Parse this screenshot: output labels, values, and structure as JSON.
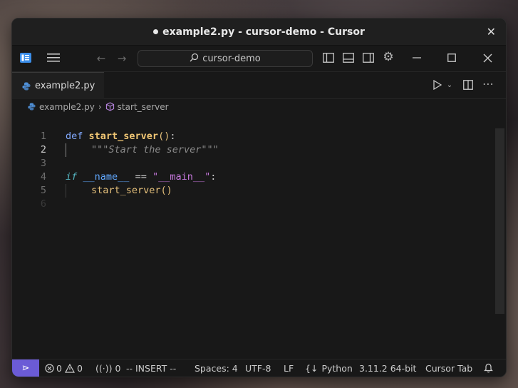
{
  "window": {
    "title": "example2.py - cursor-demo - Cursor"
  },
  "toolbar": {
    "search_text": "cursor-demo"
  },
  "tabs": [
    {
      "label": "example2.py",
      "modified": true
    }
  ],
  "breadcrumb": {
    "file": "example2.py",
    "symbol": "start_server"
  },
  "code": {
    "line_numbers": [
      "1",
      "2",
      "3",
      "4",
      "5",
      "6"
    ],
    "active_line": 2,
    "l1_kw": "def",
    "l1_fn": "start_server",
    "l1_paren": "()",
    "l1_colon": ":",
    "l2_doc": "\"\"\"Start the server\"\"\"",
    "l4_if": "if",
    "l4_name": "__name__",
    "l4_eq": "==",
    "l4_str": "\"__main__\"",
    "l4_colon": ":",
    "l5_call": "start_server",
    "l5_paren": "()"
  },
  "status": {
    "errors": "0",
    "warnings": "0",
    "ports": "0",
    "mode": "-- INSERT --",
    "spaces": "Spaces: 4",
    "encoding": "UTF-8",
    "eol": "LF",
    "language": "Python",
    "interpreter": "3.11.2 64-bit",
    "cursor_tab": "Cursor Tab"
  },
  "colors": {
    "accent": "#6b5bd6",
    "keyword": "#82aaff",
    "function": "#f0c674"
  },
  "icons": [
    "cursor-logo-icon",
    "menu-icon",
    "arrow-left-icon",
    "arrow-right-icon",
    "search-icon",
    "toggle-primary-sidebar-icon",
    "toggle-panel-icon",
    "toggle-secondary-sidebar-icon",
    "settings-gear-icon",
    "minimize-icon",
    "maximize-icon",
    "close-icon",
    "python-file-icon",
    "symbol-method-icon",
    "run-icon",
    "split-editor-icon",
    "more-actions-icon",
    "remote-icon",
    "error-icon",
    "warning-icon",
    "broadcast-icon",
    "python-braces-icon",
    "bell-icon"
  ]
}
